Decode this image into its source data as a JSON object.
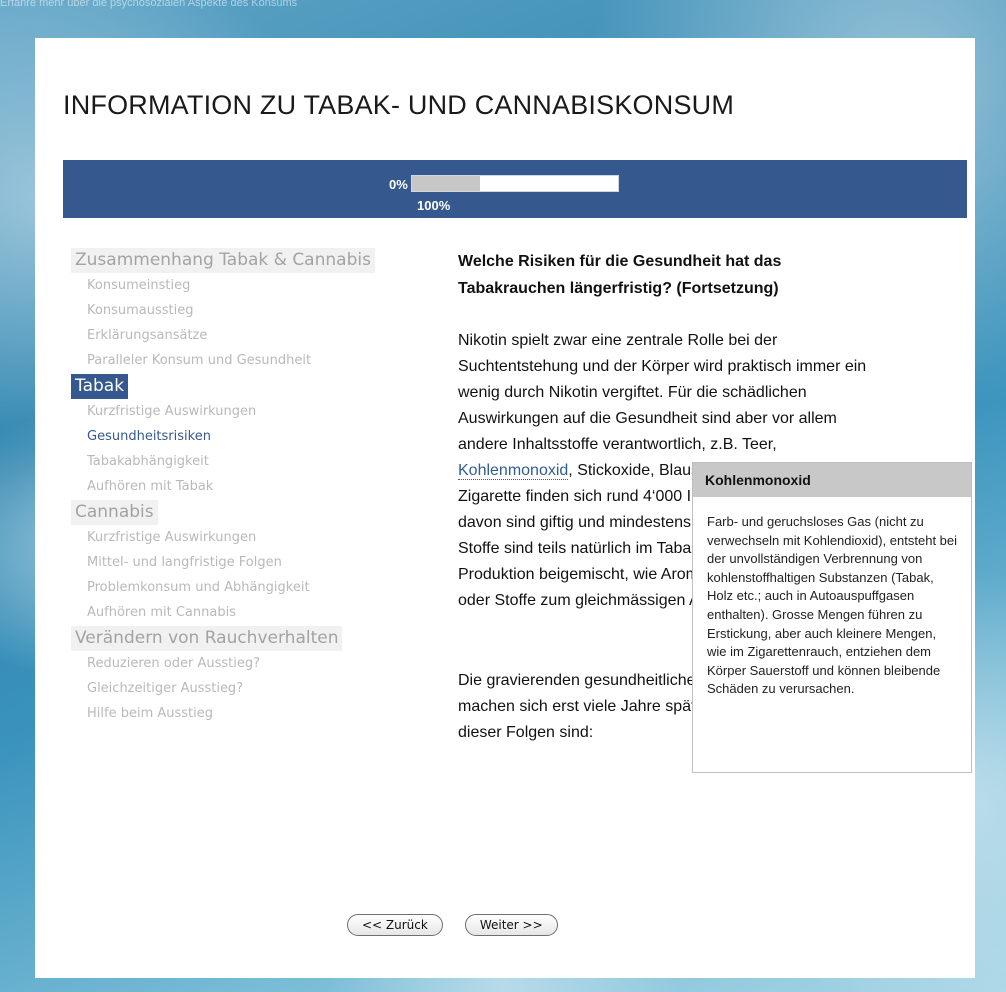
{
  "top_strip_text": "Erfahre mehr über die psychosozialen Aspekte des Konsums",
  "page_title": "INFORMATION ZU TABAK- UND CANNABISKONSUM",
  "progress": {
    "min_label": "0%",
    "max_label": "100%",
    "value_fraction": 0.33,
    "bar_color": "#35598e",
    "fill_color": "#c7c7c7"
  },
  "sidebar": {
    "groups": [
      {
        "title": "Zusammenhang Tabak  & Cannabis",
        "active": false,
        "items": [
          {
            "label": "Konsumeinstieg",
            "current": false
          },
          {
            "label": "Konsumausstieg",
            "current": false
          },
          {
            "label": "Erklärungsansätze",
            "current": false
          },
          {
            "label": "Paralleler Konsum und Gesundheit",
            "current": false
          }
        ]
      },
      {
        "title": "Tabak",
        "active": true,
        "items": [
          {
            "label": "Kurzfristige Auswirkungen",
            "current": false
          },
          {
            "label": "Gesundheitsrisiken",
            "current": true
          },
          {
            "label": "Tabakabhängigkeit",
            "current": false
          },
          {
            "label": "Aufhören mit Tabak",
            "current": false
          }
        ]
      },
      {
        "title": "Cannabis",
        "active": false,
        "items": [
          {
            "label": "Kurzfristige Auswirkungen",
            "current": false
          },
          {
            "label": "Mittel- und langfristige Folgen",
            "current": false
          },
          {
            "label": "Problemkonsum und Abhängigkeit",
            "current": false
          },
          {
            "label": "Aufhören mit Cannabis",
            "current": false
          }
        ]
      },
      {
        "title": "Verändern von Rauchverhalten",
        "active": false,
        "items": [
          {
            "label": "Reduzieren oder Ausstieg?",
            "current": false
          },
          {
            "label": "Gleichzeitiger Ausstieg?",
            "current": false
          },
          {
            "label": "Hilfe beim Ausstieg",
            "current": false
          }
        ]
      }
    ]
  },
  "content": {
    "heading": "Welche Risiken für die Gesundheit hat das Tabakrauchen längerfristig? (Fortsetzung)",
    "p1_before": "Nikotin spielt zwar eine zentrale Rolle bei der Suchtentstehung und der Körper wird praktisch immer ein wenig durch Nikotin vergiftet. Für die schädlichen Auswirkungen auf die Gesundheit sind aber vor allem andere Inhaltsstoffe verantwortlich, z.B. Teer, ",
    "p1_link": "Kohlenmonoxid",
    "p1_after": ", Stickoxide, Blausäure. In einer heutigen Zigarette finden sich rund 4‘000 Inhaltsstoffe, über 20 davon sind giftig und mindestens 40 krebserregend. Diese Stoffe sind teils natürlich im Tabak vor oder werden bei der Produktion beigemischt, wie Aromen, Feuchthaltemittel oder Stoffe zum gleichmässigen Abbrennen der Zigarette.",
    "p2": "Die gravierenden gesundheitlichen Folgen des Rauchens machen sich erst viele Jahre später bemerkbar. Einige dieser Folgen sind:"
  },
  "tooltip": {
    "title": "Kohlenmonoxid",
    "body": "Farb- und geruchsloses Gas (nicht zu verwechseln mit Kohlendioxid), entsteht bei der unvollständigen Verbrennung von kohlenstoffhaltigen Substanzen (Tabak, Holz etc.; auch in Autoauspuffgasen enthalten). Grosse Mengen führen zu Erstickung, aber auch kleinere Mengen, wie im Zigarettenrauch, entziehen dem Körper Sauerstoff und können bleibende Schäden zu verursachen."
  },
  "buttons": {
    "back": "<< Zurück",
    "next": "Weiter >>"
  }
}
